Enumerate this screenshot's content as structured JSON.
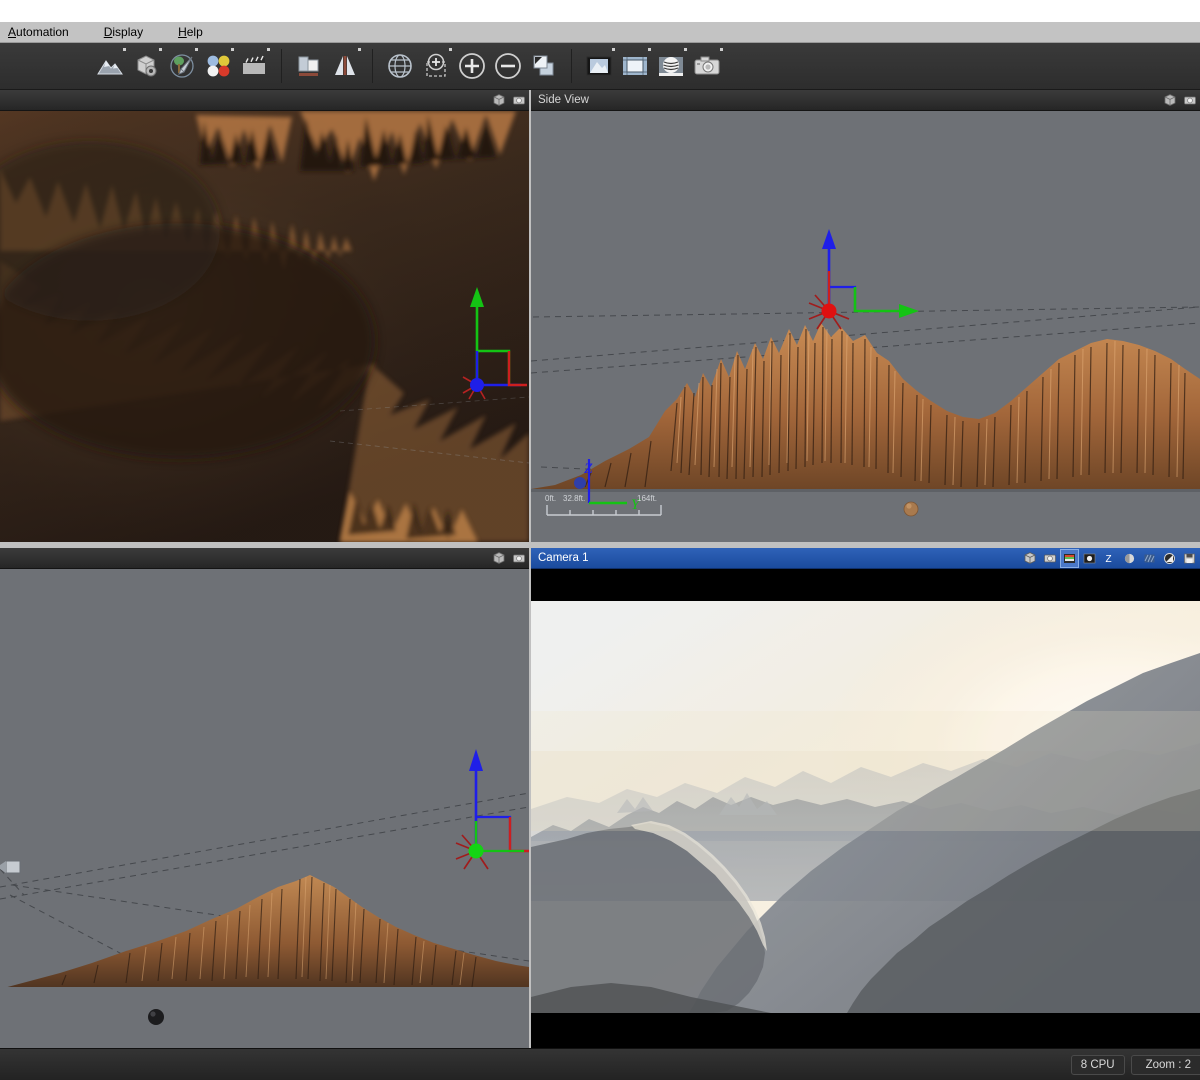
{
  "app": {
    "menubar": [
      {
        "label": "Automation",
        "mnemonic": "A"
      },
      {
        "label": "Display",
        "mnemonic": "D"
      },
      {
        "label": "Help",
        "mnemonic": "H"
      }
    ]
  },
  "toolbar": {
    "groups": [
      {
        "buttons": [
          {
            "name": "terrain-icon",
            "label": "Terrain"
          },
          {
            "name": "object-icon",
            "label": "Objects"
          },
          {
            "name": "atmosphere-icon",
            "label": "Atmosphere"
          },
          {
            "name": "materials-icon",
            "label": "Materials"
          },
          {
            "name": "animation-icon",
            "label": "Animation"
          }
        ]
      },
      {
        "buttons": [
          {
            "name": "layout-icon",
            "label": "Layout"
          },
          {
            "name": "mirror-icon",
            "label": "Mirror"
          }
        ]
      },
      {
        "buttons": [
          {
            "name": "globe-icon",
            "label": "Planet"
          },
          {
            "name": "zoom-region-icon",
            "label": "Zoom Region"
          },
          {
            "name": "zoom-in-icon",
            "label": "Zoom In"
          },
          {
            "name": "zoom-out-icon",
            "label": "Zoom Out"
          },
          {
            "name": "move-copy-icon",
            "label": "Move / Copy"
          }
        ]
      },
      {
        "buttons": [
          {
            "name": "render-preview-icon",
            "label": "Render Preview"
          },
          {
            "name": "crop-frame-icon",
            "label": "Crop Frame"
          },
          {
            "name": "sphere-render-icon",
            "label": "Sphere Render"
          },
          {
            "name": "camera-icon",
            "label": "Camera"
          }
        ]
      }
    ]
  },
  "viewports": {
    "top_left": {
      "title": "",
      "active": false,
      "header_icons": [
        "cube-icon",
        "camera-icon"
      ],
      "gizmo": {
        "up_axis": "green",
        "right_axis": "red",
        "origin": "blue"
      }
    },
    "top_right": {
      "title": "Side View",
      "active": false,
      "header_icons": [
        "cube-icon",
        "camera-icon"
      ],
      "gizmo": {
        "up_axis": "blue",
        "right_axis": "green",
        "origin": "red"
      },
      "mini_axes": {
        "vertical": "Z",
        "horizontal": "Y"
      },
      "scale_bar": {
        "start": "0ft.",
        "middle": "32.8ft.",
        "end": "164ft."
      }
    },
    "bottom_left": {
      "title": "",
      "active": false,
      "header_icons": [
        "cube-icon",
        "camera-icon"
      ],
      "gizmo": {
        "up_axis": "blue",
        "right_axis": "red",
        "origin": "green"
      }
    },
    "bottom_right": {
      "title": "Camera 1",
      "active": true,
      "header_icons": [
        "cube-icon",
        "camera-icon",
        "color-layers-icon",
        "alpha-dot-icon",
        "z-depth-icon",
        "sphere-shade-icon",
        "hatch-icon",
        "contrast-icon",
        "save-icon"
      ],
      "selected_header_icon": "color-layers-icon"
    }
  },
  "statusbar": {
    "cpu_label": "8 CPU",
    "zoom_label": "Zoom : 2"
  },
  "colors": {
    "menubar_bg": "#c3c3c3",
    "toolbar_bg": "#2f2f2f",
    "viewport_bg": "#6e7176",
    "active_title_bg": "#1f55a8",
    "terrain_lit": "#b87a4a",
    "terrain_shadow": "#2a1a12",
    "axis_x": "#cc2222",
    "axis_y": "#11bb11",
    "axis_z": "#2222ee",
    "status_text": "#d9d9d9"
  }
}
